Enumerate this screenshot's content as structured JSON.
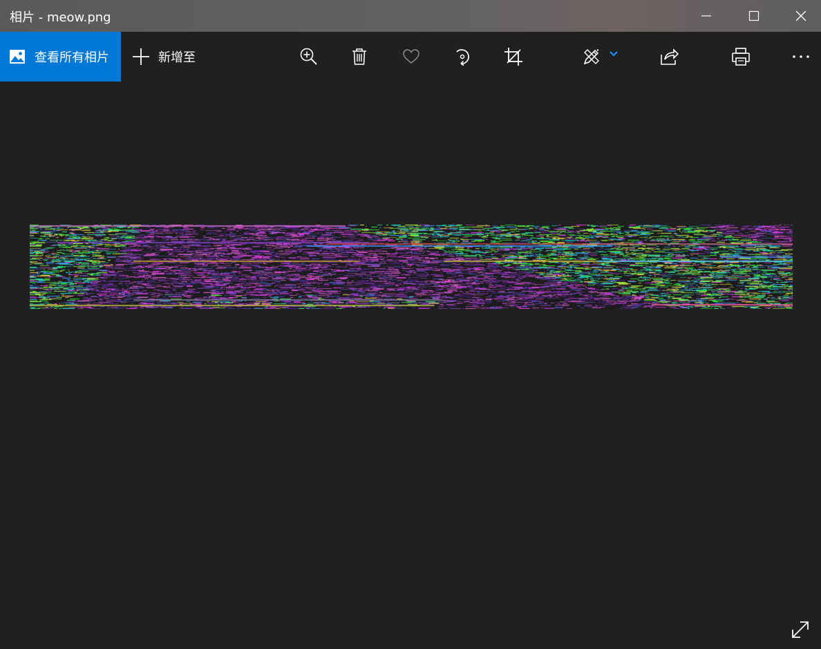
{
  "window": {
    "title": "相片 - meow.png"
  },
  "toolbar": {
    "view_all_label": "查看所有相片",
    "add_to_label": "新增至",
    "accent_color": "#0078d7",
    "icons": [
      "zoom-in-icon",
      "delete-icon",
      "heart-icon",
      "rotate-icon",
      "crop-icon",
      "edit-draw-icon",
      "chevron-down-icon",
      "share-icon",
      "print-icon",
      "more-icon"
    ]
  },
  "image": {
    "description_kind": "glitched noise image"
  }
}
